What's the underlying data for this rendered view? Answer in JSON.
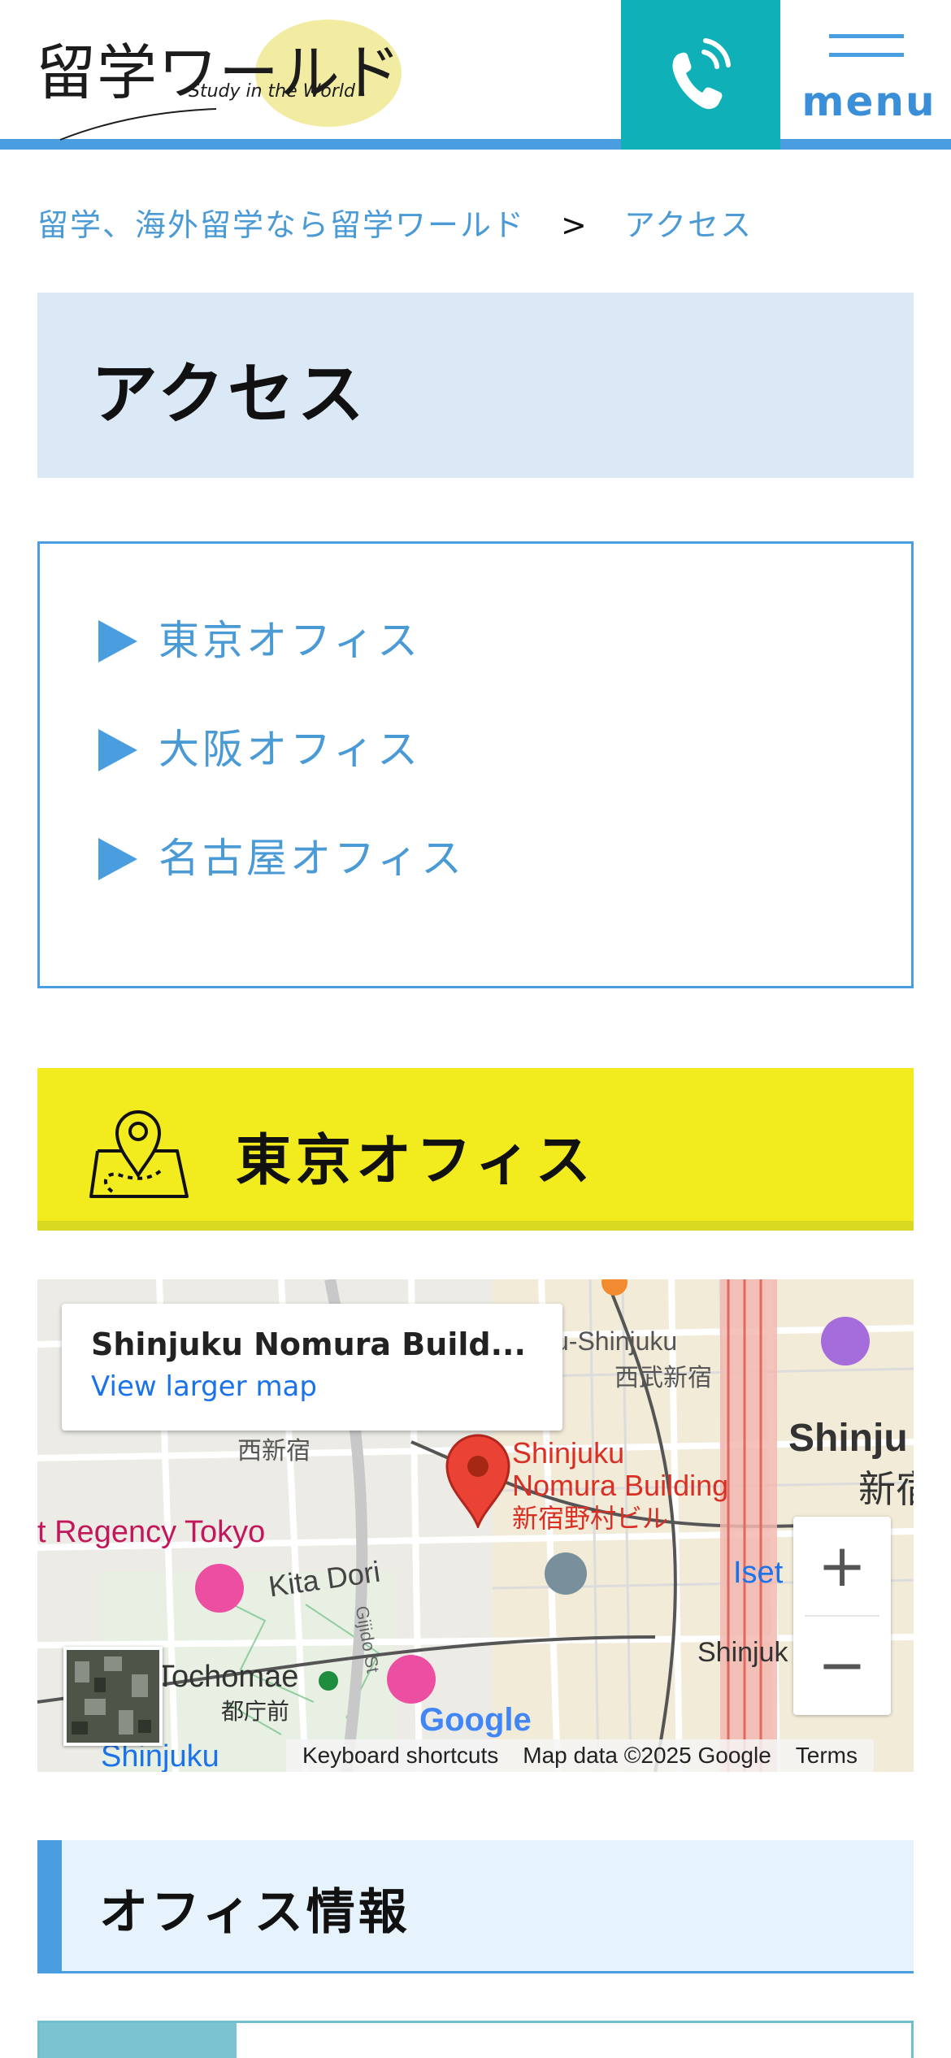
{
  "header": {
    "logo_jp": "留学ワールド",
    "logo_en": "Study in the World",
    "menu_label": "menu",
    "colors": {
      "accent": "#4a9ee0",
      "phone_bg": "#0fb0b8",
      "logo_circle": "#f2eca3"
    }
  },
  "breadcrumb": {
    "home": "留学、海外留学なら留学ワールド",
    "separator": ">",
    "current": "アクセス"
  },
  "page_title": "アクセス",
  "office_links": [
    {
      "label": "東京オフィス"
    },
    {
      "label": "大阪オフィス"
    },
    {
      "label": "名古屋オフィス"
    }
  ],
  "tokyo": {
    "title": "東京オフィス",
    "icon": "map-pin-icon",
    "heading_color": "#f2ec1e"
  },
  "map": {
    "card_title": "Shinjuku Nomura Build...",
    "card_link": "View larger map",
    "pin_label_en_1": "Shinjuku",
    "pin_label_en_2": "Nomura Building",
    "pin_label_jp": "新宿野村ビル",
    "labels": {
      "nishishinjuku_partial": "u-Shinjuku",
      "seibu_shinjuku": "西武新宿",
      "shinjuku_big": "Shinju",
      "shinjuku_big_jp": "新宿",
      "nishi_shinjuku_jp": "西新宿",
      "regency": "t Regency Tokyo",
      "kita_dori": "Kita Dori",
      "gijido": "Gijido St",
      "isetan": "Iset",
      "tochomae": "Tochomae",
      "tochomae_jp": "都庁前",
      "shinjuku_bottom": "Shinjuku",
      "shinjuku_station_partial": "Shinjuk",
      "google": "Google"
    },
    "zoom_in": "+",
    "zoom_out": "−",
    "footer": {
      "shortcuts": "Keyboard shortcuts",
      "map_data": "Map data ©2025 Google",
      "terms": "Terms"
    }
  },
  "office_info": {
    "title": "オフィス情報"
  }
}
